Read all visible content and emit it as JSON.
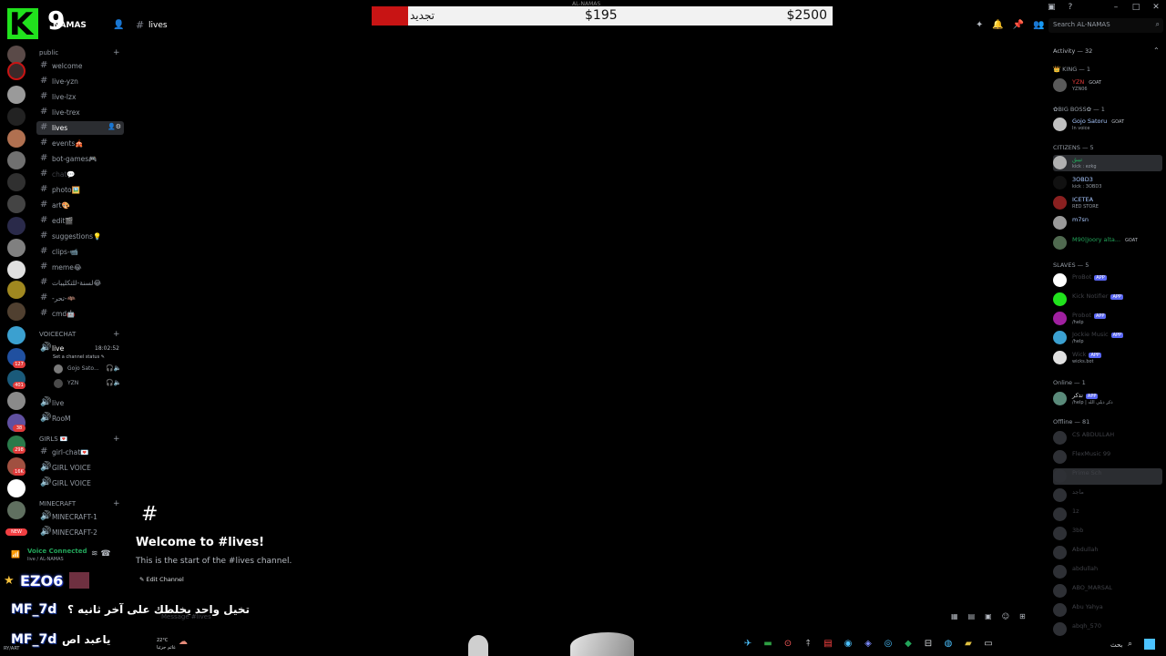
{
  "topbar": {
    "server_name": "NAMAS",
    "channel_name": "lives",
    "overlay_renew": "تجديد",
    "overlay_mid": "$195",
    "overlay_right": "$2500",
    "overlay_top": "AL-NAMAS",
    "search_placeholder": "Search AL-NAMAS",
    "logo_letter": "K",
    "logo_number": "9"
  },
  "categories": {
    "public": "public",
    "voicechat": "VOICECHAT",
    "girls": "GIRLS 💌",
    "minecraft": "MINECRAFT"
  },
  "channels": [
    {
      "name": "welcome"
    },
    {
      "name": "live-yzn"
    },
    {
      "name": "live-lzx"
    },
    {
      "name": "live-trex"
    },
    {
      "name": "lives"
    },
    {
      "name": "events🎪"
    },
    {
      "name": "bot-games🎮"
    },
    {
      "name": "chat💬"
    },
    {
      "name": "photo🖼️"
    },
    {
      "name": "art🎨"
    },
    {
      "name": "edit🎬"
    },
    {
      "name": "suggestions💡"
    },
    {
      "name": "clips-📹"
    },
    {
      "name": "meme😂"
    },
    {
      "name": "لسنة-للتكليبات😂"
    },
    {
      "name": "-تحر-🦇"
    },
    {
      "name": "cmd🤖"
    }
  ],
  "voice": {
    "live_name": "live",
    "live_time": "18:02:52",
    "live_status": "Set a channel status ✎",
    "users": [
      "Gojo Sato...",
      "YZN"
    ],
    "live2": "live",
    "room": "RooM"
  },
  "girls_channels": [
    "girl-chat💌",
    "GIRL VOICE",
    "GIRL VOICE"
  ],
  "minecraft_channels": [
    "MINECRAFT-1",
    "MINECRAFT-2"
  ],
  "rail_badges": [
    "127",
    "401",
    "38",
    "298",
    "16K"
  ],
  "new_badge": "NEW",
  "voice_connected": {
    "title": "Voice Connected",
    "sub": "live / AL-NAMAS"
  },
  "main": {
    "hash": "#",
    "welcome_title": "Welcome to #lives!",
    "welcome_sub": "This is the start of the #lives channel.",
    "edit_channel": "✎ Edit Channel",
    "message_placeholder": "Message #lives"
  },
  "stream_overlay": {
    "ezo": "EZO6",
    "line1_name": "MF_7d",
    "line1_text": "تخيل واحد يخلطك على آخر ثانيه ؟",
    "line2_name": "MF_7d",
    "line2_text": "ياعبد اص",
    "footer_user": "RY/ART",
    "weather_temp": "22°C",
    "weather_text": "غائم جزئيا",
    "tray_lang": "بحث"
  },
  "members": {
    "activity": "Activity — 32",
    "roles": [
      {
        "label": "👑 KING — 1",
        "top": 0
      },
      {
        "label": "✿BIG BOSS✿ — 1",
        "top": 0
      },
      {
        "label": "CITIZENS — 5",
        "top": 0
      },
      {
        "label": "SLAVES — 5",
        "top": 0
      },
      {
        "label": "Online — 1",
        "top": 0
      },
      {
        "label": "Offline — 81",
        "top": 0
      }
    ],
    "list": [
      {
        "name": "YZN",
        "tag": "GOAT",
        "sub": "YZN06"
      },
      {
        "name": "Gojo Satoru",
        "tag": "GOAT",
        "sub": "In voice"
      },
      {
        "name": "تيبق",
        "tag": "",
        "sub": "kick : ezkg"
      },
      {
        "name": "3OBD3",
        "tag": "",
        "sub": "kick : 3OBD3"
      },
      {
        "name": "ICETEA",
        "tag": "",
        "sub": "RED STORE"
      },
      {
        "name": "m7sn",
        "tag": "",
        "sub": ""
      },
      {
        "name": "M90|Joory alta...",
        "tag": "GOAT",
        "sub": ""
      },
      {
        "name": "ProBot",
        "tag": "APP",
        "sub": ""
      },
      {
        "name": "Kick Notifier",
        "tag": "APP",
        "sub": ""
      },
      {
        "name": "Probot",
        "tag": "APP",
        "sub": "/help"
      },
      {
        "name": "Jockie Music",
        "tag": "APP",
        "sub": "/help"
      },
      {
        "name": "Wick",
        "tag": "APP",
        "sub": "wicks.bot"
      },
      {
        "name": "تذكر",
        "tag": "APP",
        "sub": "/help | ذكر ذيلي الله"
      }
    ],
    "offline": [
      "CS ABDULLAH",
      "FlexMusic 99",
      "Prime Sch",
      "ماجد",
      "1z",
      "3bb",
      "Abdullah",
      "abdullah",
      "ABO_MARSAL",
      "Abu Yahya",
      "abqh_570"
    ]
  },
  "icons": {
    "accent": "#5865f2",
    "online": "#23a55a",
    "logo": "#21e21d",
    "renew_red": "#c81414"
  }
}
